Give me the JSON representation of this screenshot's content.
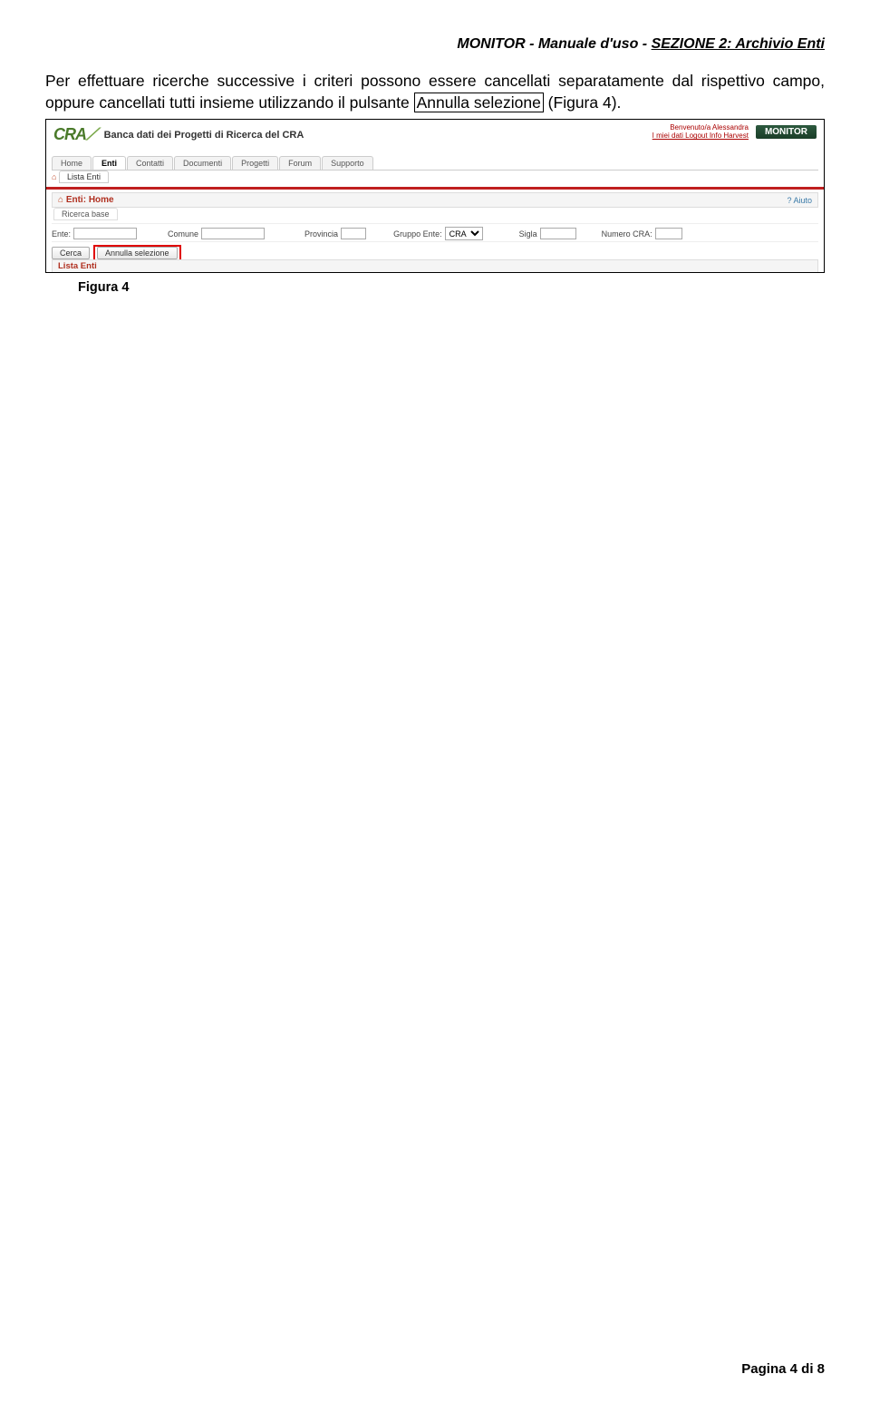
{
  "header": {
    "left": "MONITOR - Manuale d'uso - ",
    "right": "SEZIONE 2: Archivio Enti"
  },
  "paragraph": {
    "pre": "Per effettuare ricerche successive i criteri possono essere cancellati separatamente dal rispettivo campo, oppure cancellati tutti insieme utilizzando il pulsante ",
    "boxed": "Annulla selezione",
    "post": " (Figura 4)."
  },
  "screenshot": {
    "welcome": "Benvenuto/a Alessandra",
    "monitor": "MONITOR",
    "userlinks": "I miei dati Logout Info Harvest",
    "cra": "CRA",
    "cra_sub": "Banca dati dei Progetti di Ricerca del CRA",
    "tabs": [
      "Home",
      "Enti",
      "Contatti",
      "Documenti",
      "Progetti",
      "Forum",
      "Supporto"
    ],
    "subtab": "Lista Enti",
    "section_title": "Enti: Home",
    "aiuto": "? Aiuto",
    "ricerca_base": "Ricerca base",
    "fields": {
      "ente": "Ente:",
      "comune": "Comune",
      "provincia": "Provincia",
      "gruppo": "Gruppo Ente:",
      "gruppo_val": "CRA",
      "sigla": "Sigla",
      "numero": "Numero CRA:"
    },
    "buttons": {
      "cerca": "Cerca",
      "annulla": "Annulla selezione"
    },
    "lista": "Lista Enti"
  },
  "caption": "Figura 4",
  "footer": "Pagina 4 di 8"
}
